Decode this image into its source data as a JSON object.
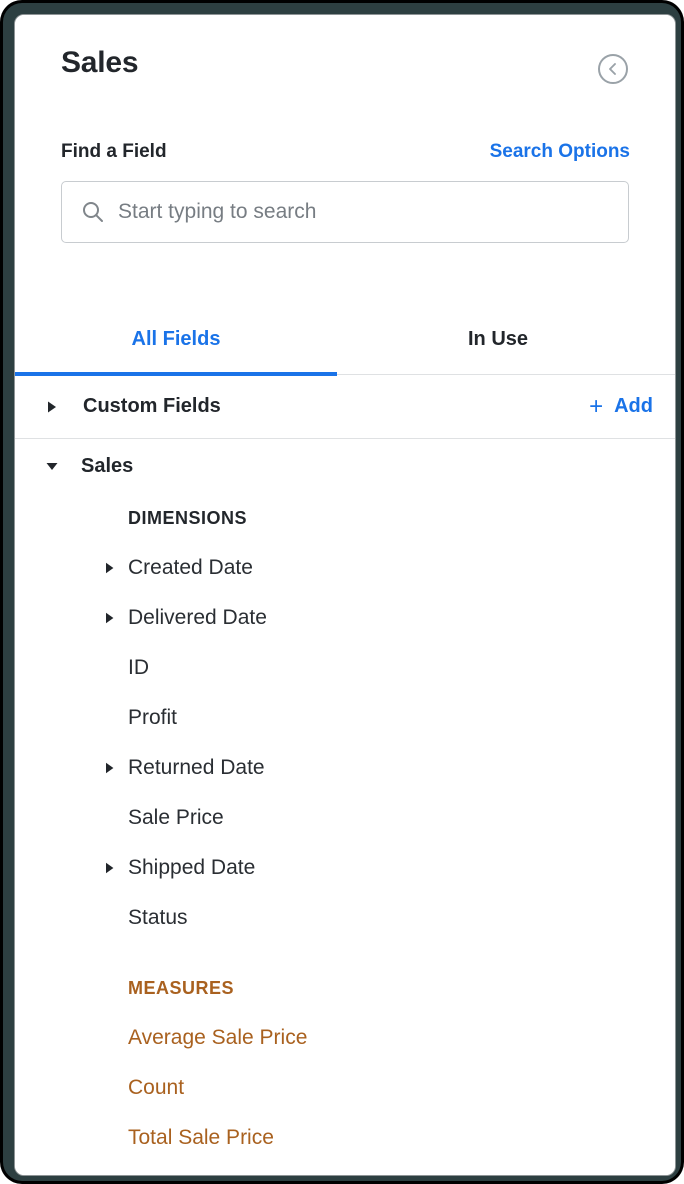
{
  "panel": {
    "title": "Sales",
    "collapse_icon": "chevron-left-circle-icon"
  },
  "search": {
    "label": "Find a Field",
    "options_link": "Search Options",
    "placeholder": "Start typing to search",
    "value": "",
    "icon": "search-icon"
  },
  "tabs": [
    {
      "label": "All Fields",
      "active": true
    },
    {
      "label": "In Use",
      "active": false
    }
  ],
  "custom_fields": {
    "label": "Custom Fields",
    "expanded": false,
    "caret_icon": "caret-right-icon",
    "add_label": "Add",
    "add_plus": "+"
  },
  "group": {
    "label": "Sales",
    "expanded": true,
    "caret_icon": "caret-down-icon"
  },
  "sections": [
    {
      "heading": "DIMENSIONS",
      "kind": "dimension",
      "fields": [
        {
          "label": "Created Date",
          "expandable": true
        },
        {
          "label": "Delivered Date",
          "expandable": true
        },
        {
          "label": "ID",
          "expandable": false
        },
        {
          "label": "Profit",
          "expandable": false
        },
        {
          "label": "Returned Date",
          "expandable": true
        },
        {
          "label": "Sale Price",
          "expandable": false
        },
        {
          "label": "Shipped Date",
          "expandable": true
        },
        {
          "label": "Status",
          "expandable": false
        }
      ]
    },
    {
      "heading": "MEASURES",
      "kind": "measure",
      "fields": [
        {
          "label": "Average Sale Price",
          "expandable": false
        },
        {
          "label": "Count",
          "expandable": false
        },
        {
          "label": "Total Sale Price",
          "expandable": false
        }
      ]
    }
  ],
  "colors": {
    "accent_blue": "#1a73e8",
    "measure_brown": "#a9611f",
    "text_dark": "#22262b",
    "field_text": "#2a2e33",
    "placeholder": "#777d83",
    "border": "#c8ccd0",
    "divider": "#dfe1e3",
    "bezel": "#2d3f41"
  }
}
